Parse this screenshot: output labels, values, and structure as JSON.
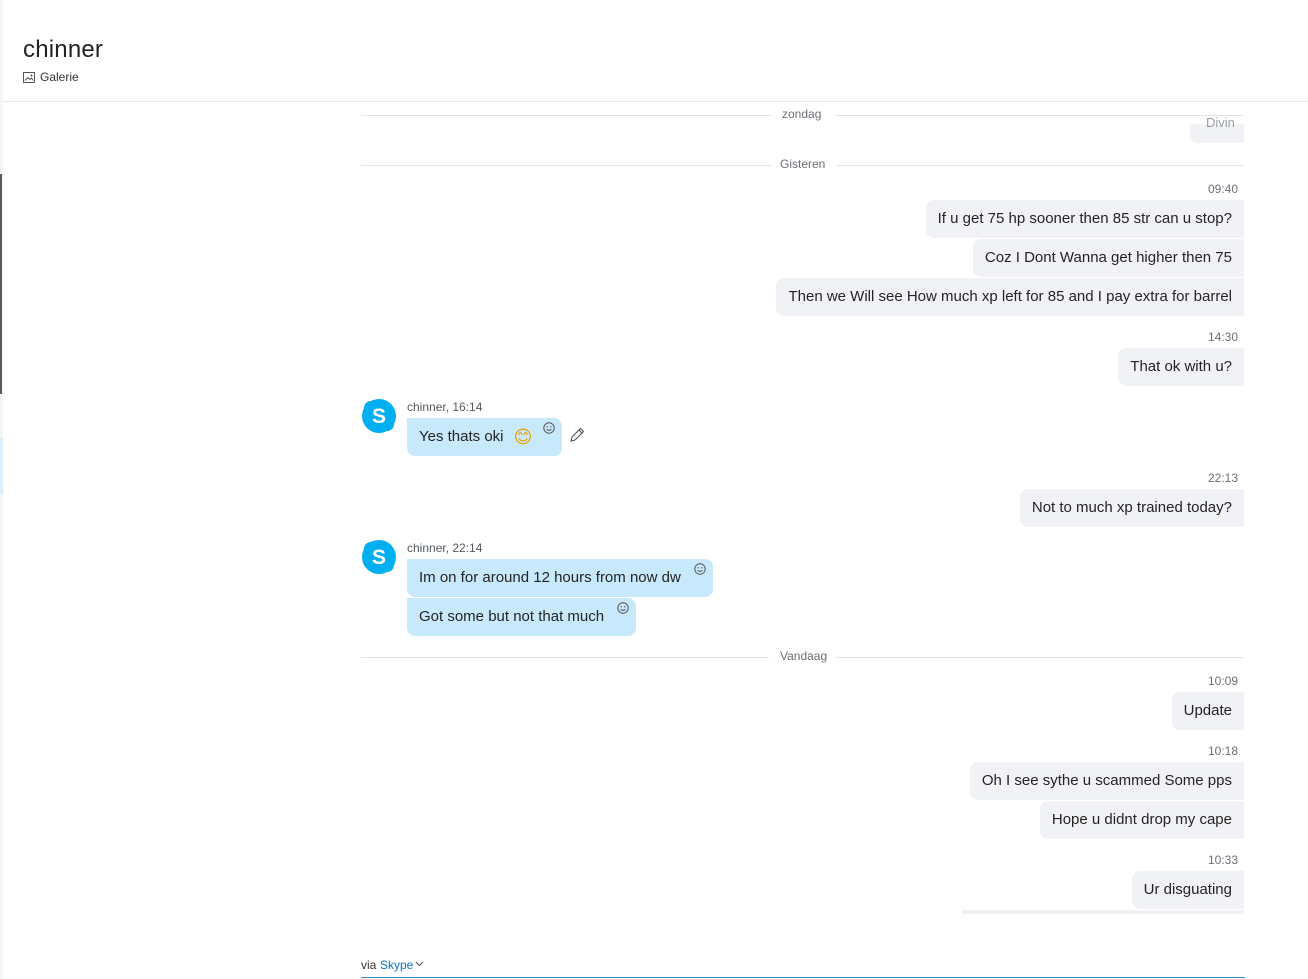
{
  "header": {
    "title": "chinner",
    "gallery_label": "Galerie",
    "gallery_icon": "image-icon"
  },
  "dividers": {
    "sunday": "zondag",
    "yesterday": "Gisteren",
    "today": "Vandaag"
  },
  "partial_top_text": "Divin",
  "times": {
    "t0940": "09:40",
    "t1430": "14:30",
    "t2213": "22:13",
    "t1009": "10:09",
    "t1018": "10:18",
    "t1033": "10:33"
  },
  "senders": {
    "s1614": "chinner, 16:14",
    "s2214": "chinner, 22:14"
  },
  "outgoing": {
    "m1": "If u get 75 hp sooner then 85 str can u stop?",
    "m2": "Coz I Dont Wanna get higher then 75",
    "m3": "Then we Will see How much xp left for 85 and I pay extra for barrel",
    "m4": "That ok with u?",
    "m5": "Not to much xp trained today?",
    "m6": "Update",
    "m7": "Oh I see sythe u scammed Some pps",
    "m8": "Hope u didnt drop my cape",
    "m9": "Ur disguating"
  },
  "incoming": {
    "i1": "Yes thats oki",
    "i1_emoji": "😊",
    "i2": "Im on for around 12 hours from now dw",
    "i3": "Got some but not that much"
  },
  "footer": {
    "via": "via",
    "service": "Skype"
  },
  "colors": {
    "incoming_bubble": "#c7e9fb",
    "outgoing_bubble": "#f1f2f5",
    "skype_blue": "#00aff0",
    "link_blue": "#0a74c4"
  }
}
